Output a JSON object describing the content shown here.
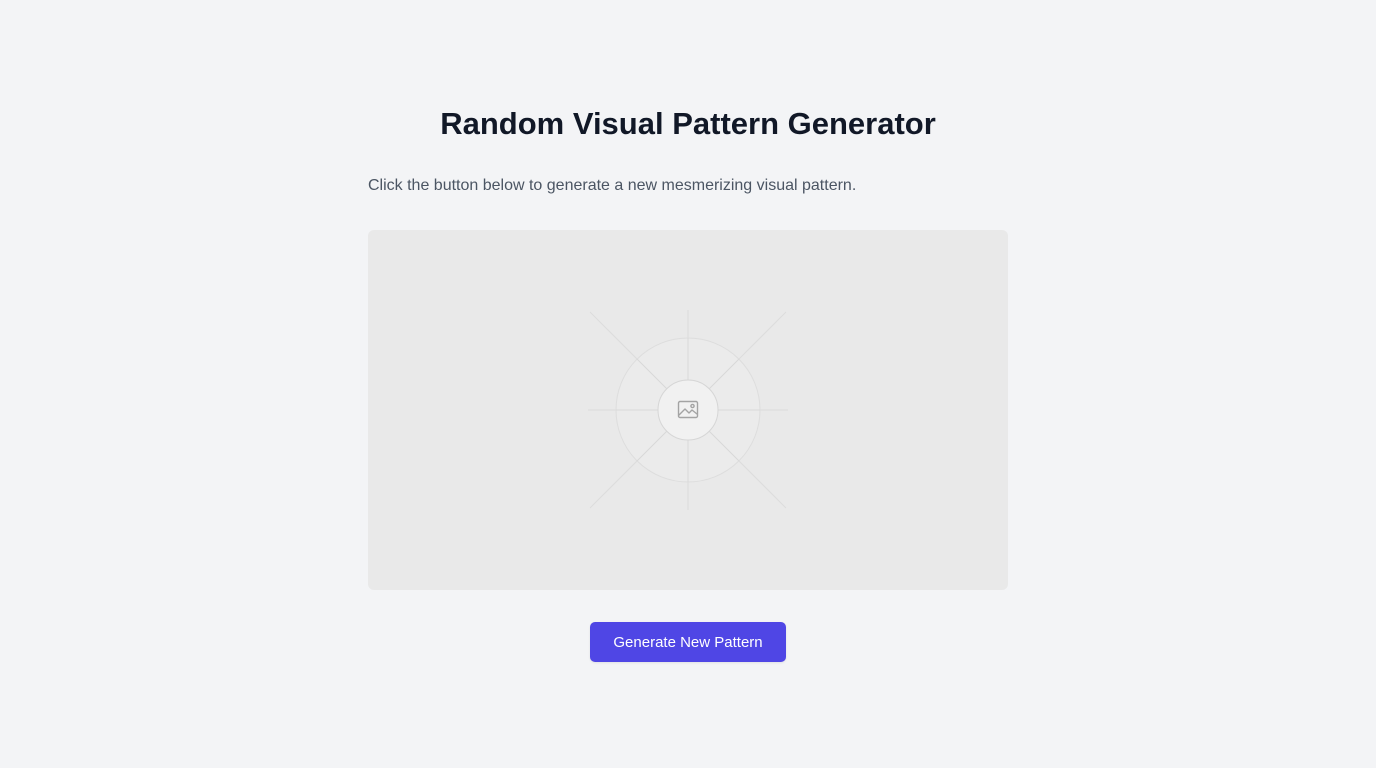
{
  "header": {
    "title": "Random Visual Pattern Generator"
  },
  "main": {
    "description": "Click the button below to generate a new mesmerizing visual pattern.",
    "canvas": {
      "placeholder_icon": "image-icon"
    },
    "generate_button_label": "Generate New Pattern"
  },
  "colors": {
    "background": "#f3f4f6",
    "title": "#111827",
    "text": "#4b5563",
    "canvas_background": "#e9e9e9",
    "accent": "#4f46e5"
  }
}
